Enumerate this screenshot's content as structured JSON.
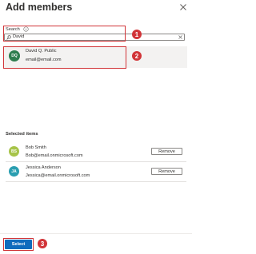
{
  "header": {
    "title": "Add members",
    "close_icon": "close-icon"
  },
  "search": {
    "label": "Search",
    "value": "David",
    "info_icon": "info-icon",
    "search_icon": "search-icon",
    "clear_icon": "close-icon"
  },
  "results": [
    {
      "initials": "DQ",
      "name": "David Q. Public",
      "email": "email@email.com",
      "avatar_color": "#2e7d4f"
    }
  ],
  "selected": {
    "title": "Selected items",
    "items": [
      {
        "initials": "BS",
        "name": "Bob Smith",
        "email": "Bob@email.onmicrosoft.com",
        "avatar_color": "#a7c449",
        "remove_label": "Remove"
      },
      {
        "initials": "JA",
        "name": "Jessica Anderson",
        "email": "Jessica@email.onmicrosoft.com",
        "avatar_color": "#2a9eb0",
        "remove_label": "Remove"
      }
    ]
  },
  "footer": {
    "select_label": "Select"
  },
  "callouts": [
    "1",
    "2",
    "3"
  ],
  "colors": {
    "callout": "#d13438",
    "primary": "#0f6cbd"
  }
}
